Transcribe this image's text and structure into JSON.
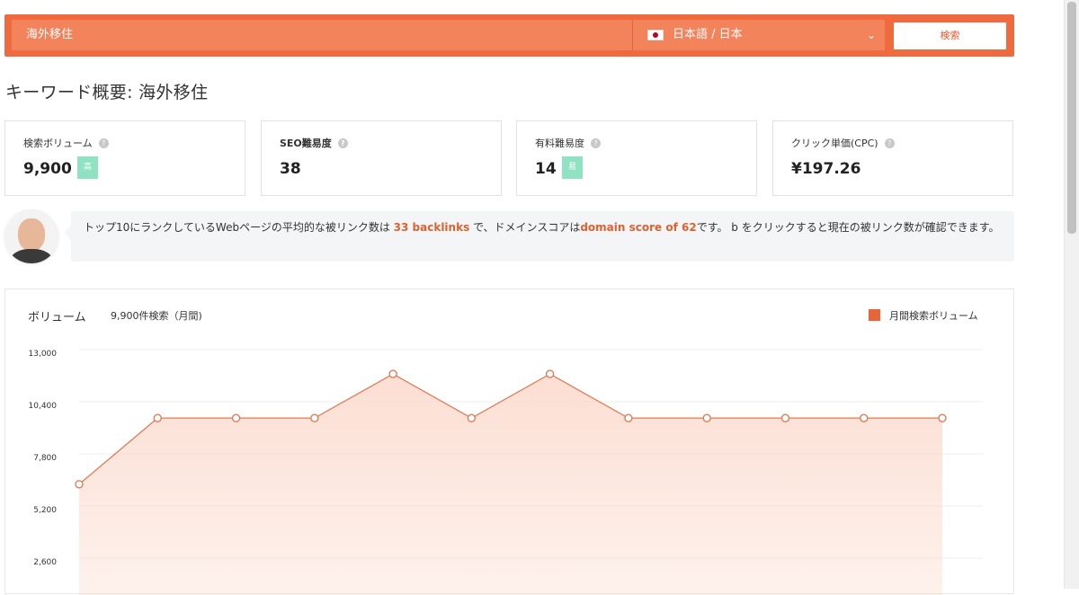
{
  "search": {
    "query": "海外移住",
    "language": "日本語 / 日本",
    "button": "検索"
  },
  "page_title": "キーワード概要: 海外移住",
  "metrics": [
    {
      "label": "検索ボリューム",
      "value": "9,900",
      "badge": "高"
    },
    {
      "label": "SEO難易度",
      "value": "38"
    },
    {
      "label": "有料難易度",
      "value": "14",
      "badge": "易"
    },
    {
      "label": "クリック単価(CPC)",
      "value": "¥197.26"
    }
  ],
  "advice": {
    "part1": "トップ10にランクしているWebページの平均的な被リンク数は ",
    "backlinks": "33 backlinks",
    "part2": " で、ドメインスコアは",
    "domain_score": "domain score of 62",
    "part3": "です。 b をクリックすると現在の被リンク数が確認できます。"
  },
  "chart": {
    "title": "ボリューム",
    "subtitle": "9,900件検索（月間)",
    "legend": "月間検索ボリューム"
  },
  "colors": {
    "accent": "#ef6a3e",
    "line": "#e27b56",
    "fill": "#fbd9cb",
    "badge": "#8fe2c2"
  },
  "chart_data": {
    "type": "area",
    "series": [
      {
        "name": "月間検索ボリューム",
        "values": [
          6600,
          9900,
          9900,
          9900,
          12100,
          9900,
          12100,
          9900,
          9900,
          9900,
          9900,
          9900
        ]
      }
    ],
    "yticks": [
      "13,000",
      "10,400",
      "7,800",
      "5,200",
      "2,600"
    ],
    "ylim": [
      0,
      13000
    ],
    "grid": true,
    "legend_position": "top-right"
  }
}
